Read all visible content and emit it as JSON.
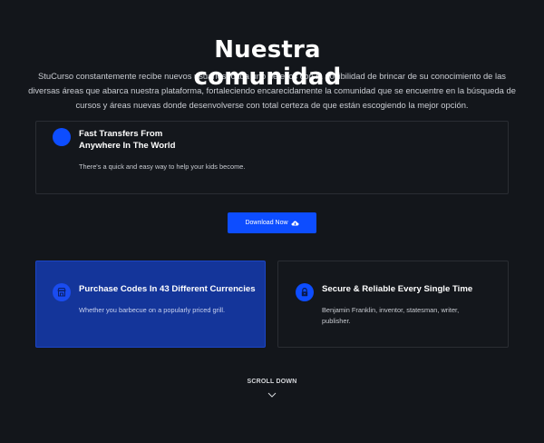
{
  "header": {
    "title_line1": "Nuestra",
    "title_line2": "comunidad",
    "intro": "StuCurso constantemente recibe nuevos usuarios, cada uno de ellos con la posibilidad de brincar de su conocimiento de las diversas áreas que abarca nuestra plataforma, fortaleciendo encarecidamente la comunidad que se encuentre en la búsqueda de cursos y áreas nuevas donde desenvolverse con total certeza de que están escogiendo la mejor opción."
  },
  "features": {
    "top": {
      "heading": "Fast Transfers From Anywhere In The World",
      "text": "There's a quick and easy way to help your kids become."
    },
    "left": {
      "heading": "Purchase Codes In 43 Different Currencies",
      "text": "Whether you barbecue on a popularly priced grill.",
      "icon": "shop-icon"
    },
    "right": {
      "heading": "Secure & Reliable Every Single Time",
      "text": "Benjamin Franklin, inventor, statesman, writer, publisher.",
      "icon": "lock-icon"
    }
  },
  "download": {
    "label": "Download Now",
    "icon": "cloud-download-icon"
  },
  "scroll": {
    "label": "SCROLL DOWN",
    "icon": "chevron-down-icon"
  },
  "colors": {
    "background": "#13161b",
    "accent": "#0d4dff",
    "highlight_card": "#14359a"
  }
}
